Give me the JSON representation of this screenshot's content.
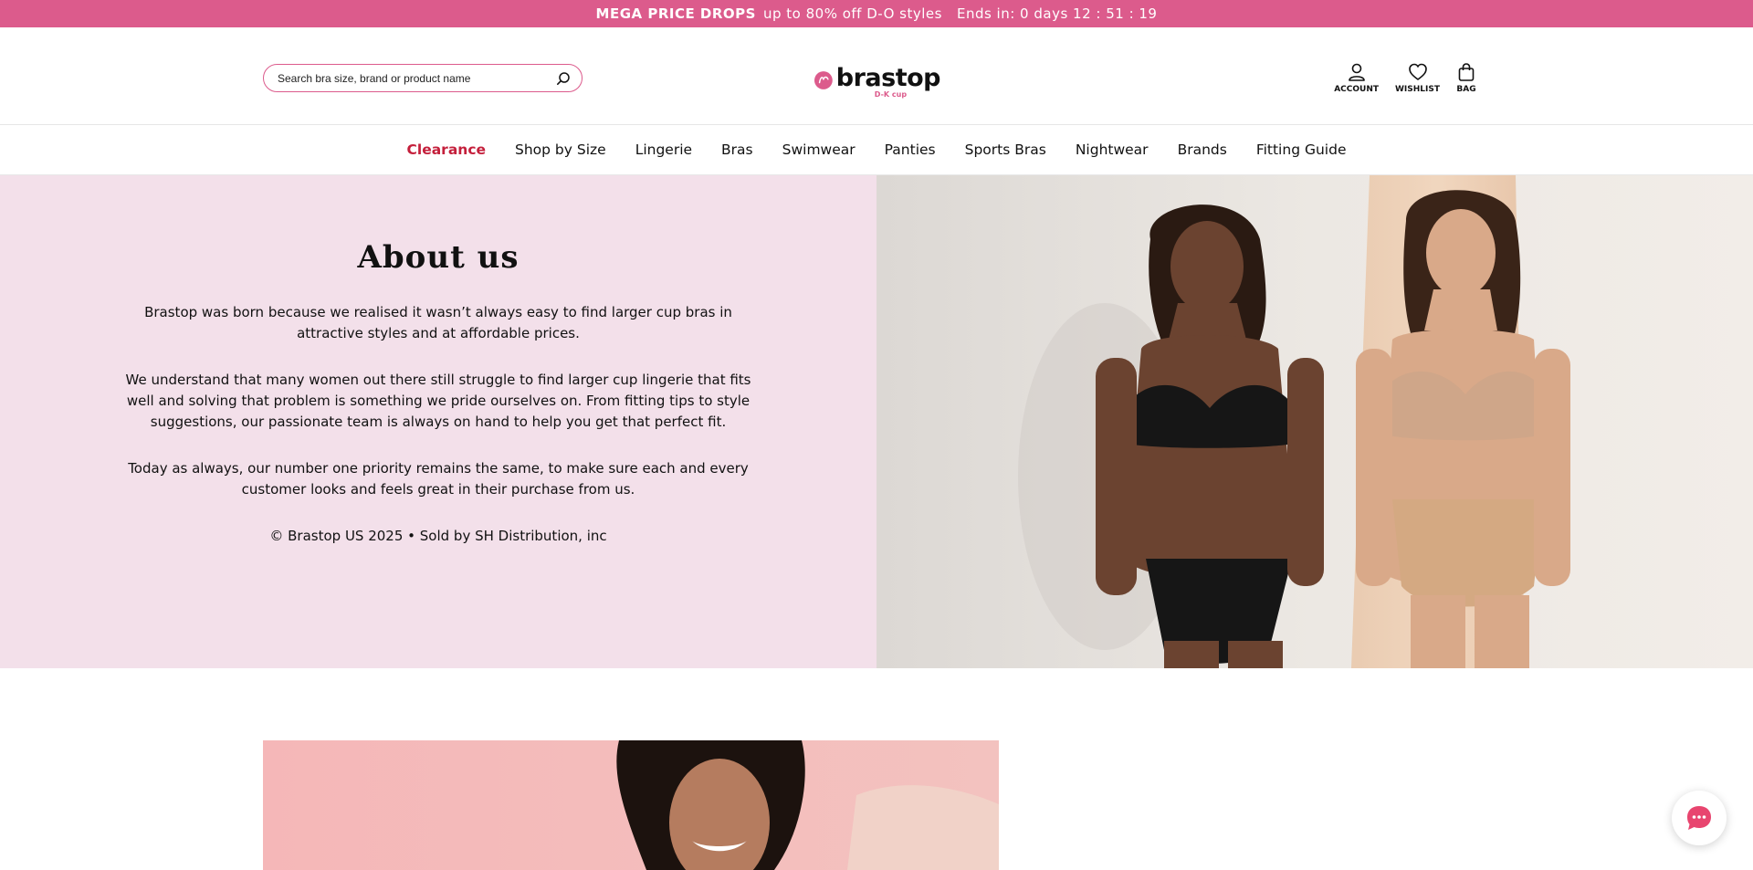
{
  "promo": {
    "headline": "MEGA PRICE DROPS",
    "detail": "up to 80% off D-O styles",
    "countdown": "Ends in: 0 days 12 : 51 : 19"
  },
  "search": {
    "placeholder": "Search bra size, brand or product name"
  },
  "logo": {
    "word": "brastop",
    "sub": "D-K cup"
  },
  "header_actions": [
    {
      "label": "ACCOUNT",
      "icon": "user-icon"
    },
    {
      "label": "WISHLIST",
      "icon": "heart-icon"
    },
    {
      "label": "BAG",
      "icon": "bag-icon"
    }
  ],
  "nav": {
    "items": [
      {
        "label": "Clearance"
      },
      {
        "label": "Shop by Size"
      },
      {
        "label": "Lingerie"
      },
      {
        "label": "Bras"
      },
      {
        "label": "Swimwear"
      },
      {
        "label": "Panties"
      },
      {
        "label": "Sports Bras"
      },
      {
        "label": "Nightwear"
      },
      {
        "label": "Brands"
      },
      {
        "label": "Fitting Guide"
      }
    ]
  },
  "about": {
    "title": "About us",
    "paragraphs": [
      "Brastop was born because we realised it wasn’t always easy to find larger cup bras in attractive styles and at affordable prices.",
      "We understand that many women out there still struggle to find larger cup lingerie that fits well and solving that problem is something we pride ourselves on. From fitting tips to style suggestions, our passionate team is always on hand to help you get that perfect fit.",
      "Today as always, our number one priority remains the same, to make sure each and every customer looks and feels great in their purchase from us."
    ],
    "copyright": "© Brastop US 2025 • Sold by SH Distribution, inc"
  },
  "colors": {
    "brand_pink": "#dc5b8c",
    "clearance_red": "#c41f3b",
    "about_bg": "#f3e0ea"
  }
}
